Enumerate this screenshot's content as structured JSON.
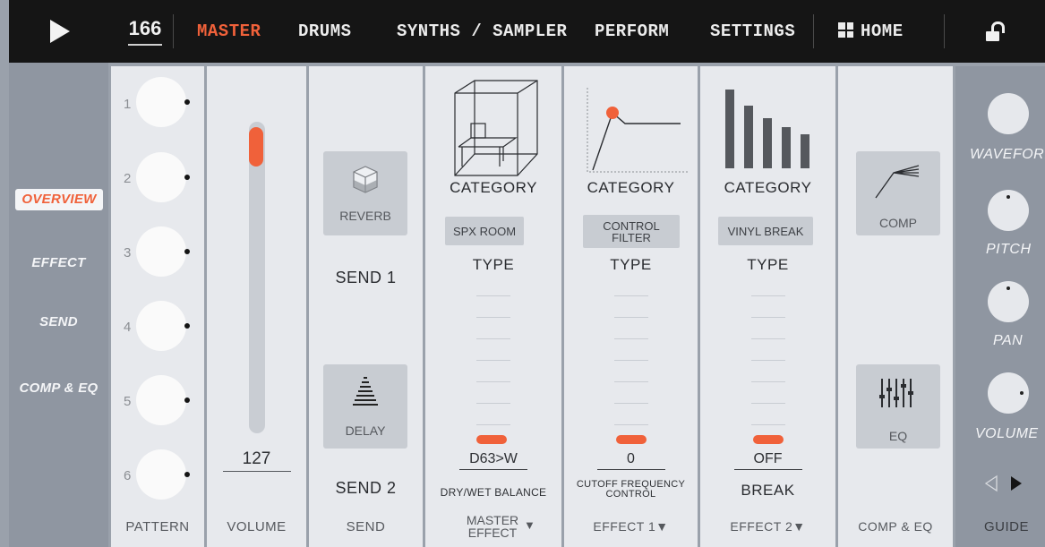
{
  "topbar": {
    "tempo": "166",
    "tabs": [
      "MASTER",
      "DRUMS",
      "SYNTHS / SAMPLER",
      "PERFORM",
      "SETTINGS"
    ],
    "home": "HOME"
  },
  "nav": [
    "OVERVIEW",
    "EFFECT",
    "SEND",
    "COMP & EQ"
  ],
  "pattern": {
    "knobs": [
      "1",
      "2",
      "3",
      "4",
      "5",
      "6"
    ],
    "label": "PATTERN"
  },
  "volume": {
    "value": "127",
    "level": 0.98,
    "label": "VOLUME"
  },
  "send": {
    "reverb": "REVERB",
    "send1": "SEND 1",
    "delay": "DELAY",
    "send2": "SEND 2",
    "label": "SEND"
  },
  "master_effect": {
    "category": "CATEGORY",
    "type_value": "SPX ROOM",
    "type_label": "TYPE",
    "value": "D63>W",
    "param": "DRY/WET BALANCE",
    "label_line1": "MASTER",
    "label_line2": "EFFECT",
    "dropdown": "▼"
  },
  "effect1": {
    "category": "CATEGORY",
    "type_line1": "CONTROL",
    "type_line2": "FILTER",
    "type_label": "TYPE",
    "value": "0",
    "param_line1": "CUTOFF FREQUENCY",
    "param_line2": "CONTROL",
    "label": "EFFECT 1▼"
  },
  "effect2": {
    "category": "CATEGORY",
    "type_value": "VINYL BREAK",
    "type_label": "TYPE",
    "value": "OFF",
    "param": "BREAK",
    "label": "EFFECT 2▼"
  },
  "comp_eq": {
    "comp": "COMP",
    "eq": "EQ",
    "label": "COMP & EQ"
  },
  "guide": {
    "labels": [
      "WAVEFORI",
      "PITCH",
      "PAN",
      "VOLUME"
    ],
    "label": "GUIDE"
  },
  "colors": {
    "accent": "#f0613a",
    "topbar": "#151515",
    "panel": "#e7e9ed",
    "nav": "#8f96a1"
  }
}
